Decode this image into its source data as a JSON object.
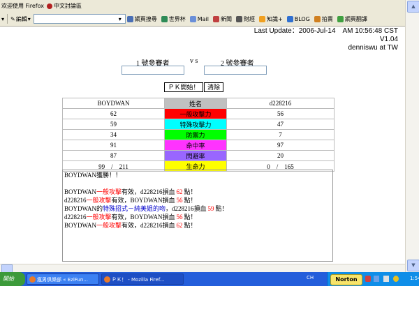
{
  "toolbar1": {
    "left_text": "欢迎使用 Firefox",
    "link_label": "中文討論區"
  },
  "toolbar2": {
    "edit_label": "編輯",
    "items": [
      {
        "label": "網頁搜尋",
        "icon": "search-icon",
        "color": "#4a6fb5"
      },
      {
        "label": "世界杯",
        "icon": "globe-icon",
        "color": "#2e8b57"
      },
      {
        "label": "Mail",
        "icon": "mail-icon",
        "color": "#6a8fd8"
      },
      {
        "label": "新聞",
        "icon": "news-icon",
        "color": "#c04040"
      },
      {
        "label": "財經",
        "icon": "finance-icon",
        "color": "#555555"
      },
      {
        "label": "知識+",
        "icon": "knowledge-icon",
        "color": "#f0a020"
      },
      {
        "label": "BLOG",
        "icon": "blog-icon",
        "color": "#3070d0"
      },
      {
        "label": "拍賣",
        "icon": "auction-icon",
        "color": "#d08020"
      },
      {
        "label": "網頁翻譯",
        "icon": "translate-icon",
        "color": "#40a040"
      }
    ]
  },
  "header": {
    "last_update": "Last Update：2006-Jul-14　AM 10:56:48 CST",
    "version": "V1.04",
    "author": "denniswu at TW"
  },
  "contest": {
    "player1_label": "1 號參賽者",
    "vs_label": "v s",
    "player2_label": "2 號參賽者",
    "start_button": "ＰＫ開始！",
    "clear_button": "清除"
  },
  "stats": {
    "player1_name": "BOYDWAN",
    "name_header": "姓名",
    "player2_name": "d228216",
    "rows": [
      {
        "p1": "62",
        "label": "一般攻擊力",
        "p2": "56",
        "color": "#ff0000"
      },
      {
        "p1": "59",
        "label": "特殊攻擊力",
        "p2": "47",
        "color": "#00ffff"
      },
      {
        "p1": "34",
        "label": "防禦力",
        "p2": "7",
        "color": "#00ff00"
      },
      {
        "p1": "91",
        "label": "命中率",
        "p2": "97",
        "color": "#ff33ff"
      },
      {
        "p1": "87",
        "label": "閃避率",
        "p2": "20",
        "color": "#9966ff"
      },
      {
        "p1": "99　/　211",
        "label": "生命力",
        "p2": "0　/　165",
        "color": "#ffff00"
      }
    ]
  },
  "log": {
    "winner": "BOYDWAN獲勝！！",
    "lines": [
      {
        "a": "BOYDWAN",
        "atk": "一般攻擊",
        "mid": "有效，d228216損血",
        "dmg": "62",
        "end": "點！"
      },
      {
        "a": "d228216",
        "atk": "一般攻擊",
        "mid": "有效，BOYDWAN損血",
        "dmg": "56",
        "end": "點！"
      },
      {
        "a": "BOYDWAN的",
        "atk": "特殊招式－純美姐的吻",
        "mid": "，d228216損血",
        "dmg": "59",
        "end": "點！"
      },
      {
        "a": "d228216",
        "atk": "一般攻擊",
        "mid": "有效，BOYDWAN損血",
        "dmg": "56",
        "end": "點！"
      },
      {
        "a": "BOYDWAN",
        "atk": "一般攻擊",
        "mid": "有效，d228216損血",
        "dmg": "62",
        "end": "點！"
      }
    ],
    "colors": {
      "normal": "#ff0000",
      "special": "#0000cc",
      "damage": "#ff0000"
    }
  },
  "taskbar": {
    "start_label": "開始",
    "tasks": [
      {
        "label": "瘋男俱樂部 « EziFun..."
      },
      {
        "label": "ＰＫ！ - Mozilla Firef..."
      }
    ],
    "lang": "CH",
    "norton": "Norton",
    "time": "1:54"
  }
}
